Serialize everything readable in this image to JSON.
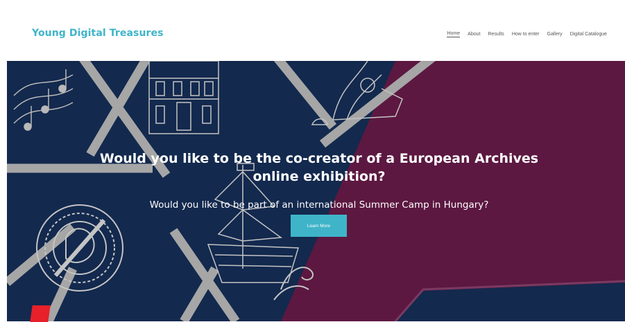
{
  "site": {
    "logo": "Young Digital Treasures"
  },
  "nav": {
    "items": [
      {
        "label": "Home",
        "active": true
      },
      {
        "label": "About",
        "active": false
      },
      {
        "label": "Results",
        "active": false
      },
      {
        "label": "How to enter",
        "active": false
      },
      {
        "label": "Gallery",
        "active": false
      },
      {
        "label": "Digital Catalogue",
        "active": false
      }
    ]
  },
  "hero": {
    "headline": "Would you like to be the co-creator of a European Archives online exhibition?",
    "subline": "Would you like to be part of an international Summer Camp in Hungary?",
    "cta_label": "Learn More"
  },
  "colors": {
    "brand_teal": "#3fb4c8",
    "navy": "#13294e",
    "maroon": "#5c1841",
    "stripe_gray": "#a6a6a6",
    "red_accent": "#e8202a"
  },
  "icons": [
    "music-notes-icon",
    "building-icon",
    "sculpture-icon",
    "wreath-seal-icon",
    "ship-icon",
    "wave-icon"
  ]
}
